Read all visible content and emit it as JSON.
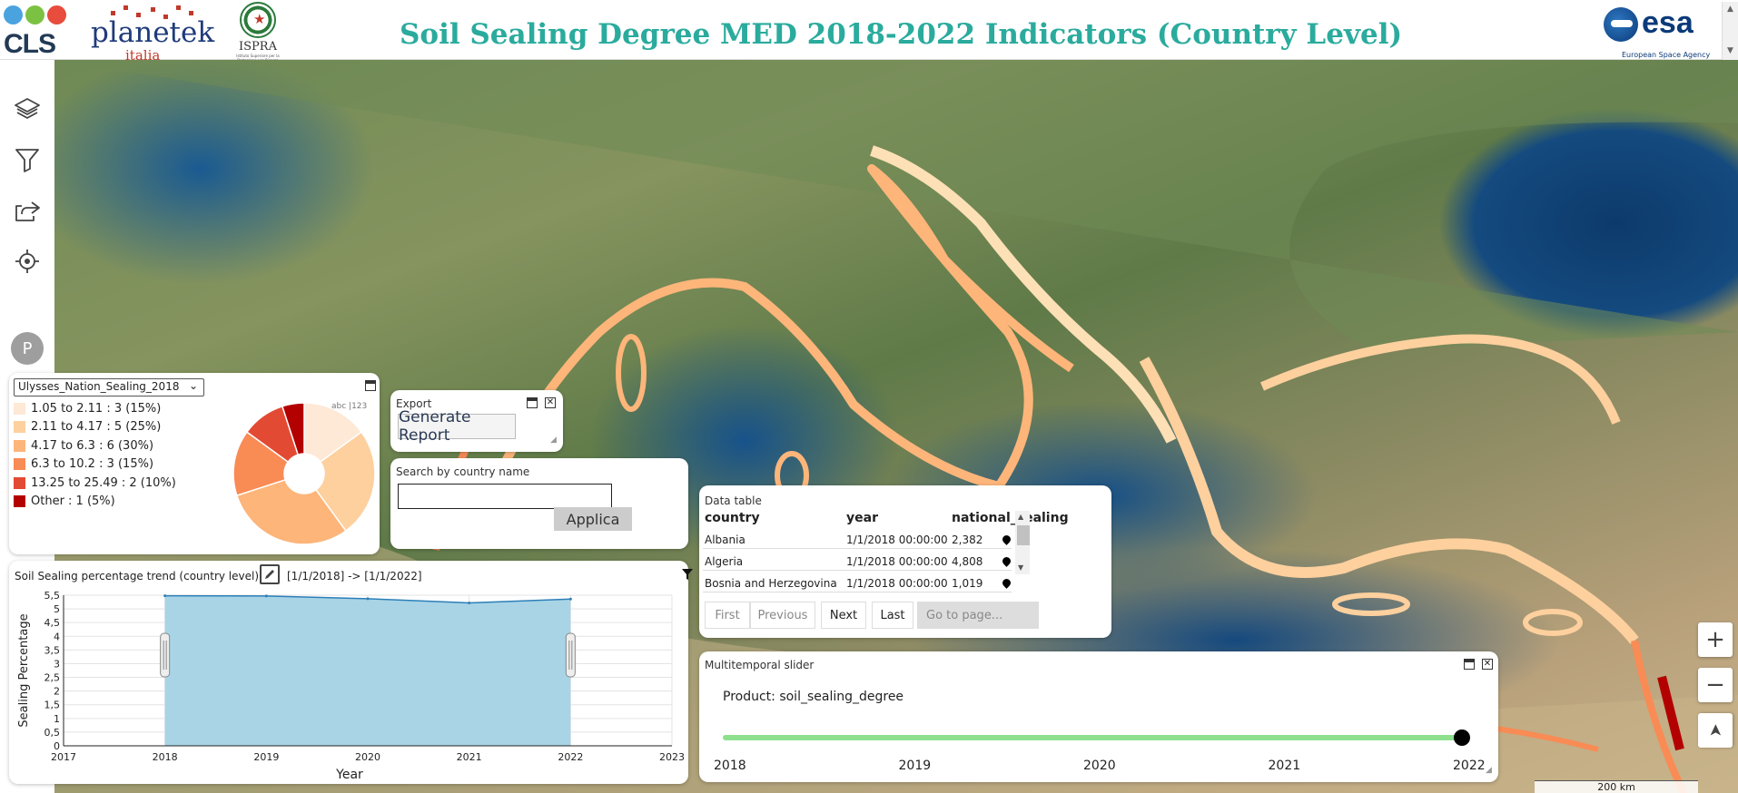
{
  "header": {
    "title": "Soil Sealing Degree MED 2018-2022 Indicators (Country Level)",
    "logos": {
      "cls": "CLS",
      "planetek": "planetek",
      "planetek_sub": "italia",
      "ispra": "ISPRA",
      "ispra_sub": "Istituto Superiore per la Protezione e la Ricerca Ambientale",
      "esa": "esa",
      "esa_sub": "European Space Agency"
    }
  },
  "toolbar": {
    "icons": [
      "layers-icon",
      "filter-icon",
      "share-icon",
      "locate-icon"
    ],
    "avatar_initial": "P"
  },
  "legend": {
    "layer_name": "Ulysses_Nation_Sealing_2018",
    "pie_label": "abc |123",
    "classes": [
      {
        "label": "1.05 to 2.11 : 3 (15%)",
        "color": "#fee8d6",
        "value": 3
      },
      {
        "label": "2.11 to 4.17 : 5 (25%)",
        "color": "#fdd09e",
        "value": 5
      },
      {
        "label": "4.17 to 6.3 : 6 (30%)",
        "color": "#fdb57a",
        "value": 6
      },
      {
        "label": "6.3 to 10.2 : 3 (15%)",
        "color": "#f98b55",
        "value": 3
      },
      {
        "label": "13.25 to 25.49 : 2 (10%)",
        "color": "#e34a33",
        "value": 2
      },
      {
        "label": "Other : 1 (5%)",
        "color": "#b30000",
        "value": 1
      }
    ]
  },
  "export": {
    "title": "Export",
    "button_label": "Generate Report"
  },
  "search": {
    "title": "Search by country name",
    "value": "",
    "button_label": "Applica"
  },
  "data_table": {
    "title": "Data table",
    "columns": [
      "country",
      "year",
      "national_sealing"
    ],
    "rows": [
      {
        "country": "Albania",
        "year": "1/1/2018 00:00:00",
        "national_sealing": "2,382"
      },
      {
        "country": "Algeria",
        "year": "1/1/2018 00:00:00",
        "national_sealing": "4,808"
      },
      {
        "country": "Bosnia and Herzegovina",
        "year": "1/1/2018 00:00:00",
        "national_sealing": "1,019"
      }
    ],
    "pager": {
      "first": "First",
      "previous": "Previous",
      "next": "Next",
      "last": "Last",
      "goto_placeholder": "Go to page..."
    }
  },
  "slider": {
    "title": "Multitemporal slider",
    "product_label": "Product: soil_sealing_degree",
    "ticks": [
      "2018",
      "2019",
      "2020",
      "2021",
      "2022"
    ],
    "selected_fraction": 1.0
  },
  "trend": {
    "title": "Soil Sealing percentage trend (country level)",
    "range": "[1/1/2018] -> [1/1/2022]"
  },
  "map": {
    "scale_label": "200 km",
    "zoom_in": "+",
    "zoom_out": "−",
    "north": "➤"
  },
  "chart_data": {
    "type": "area",
    "title": "",
    "xlabel": "Year",
    "ylabel": "Sealing Percentage",
    "x": [
      2018,
      2019,
      2020,
      2021,
      2022
    ],
    "x_ticks": [
      "2017",
      "2018",
      "2019",
      "2020",
      "2021",
      "2022",
      "2023"
    ],
    "y_ticks": [
      "0",
      "0,5",
      "1",
      "1,5",
      "2",
      "2,5",
      "3",
      "3,5",
      "4",
      "4,5",
      "5",
      "5,5"
    ],
    "values": [
      5.48,
      5.47,
      5.37,
      5.22,
      5.36
    ],
    "xlim": [
      2017,
      2023
    ],
    "ylim": [
      0,
      5.5
    ],
    "grid": true,
    "fill_color": "#a8d4e6",
    "line_color": "#2c7fb8"
  }
}
